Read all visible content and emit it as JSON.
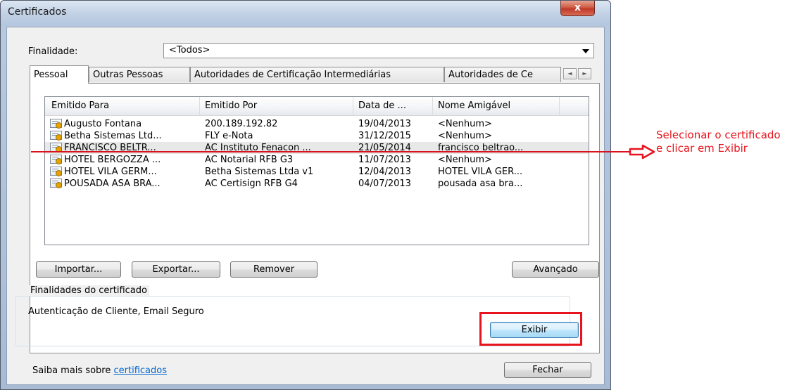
{
  "window": {
    "title": "Certificados",
    "close_label": "x"
  },
  "purpose": {
    "label": "Finalidade:",
    "value": "<Todos>"
  },
  "tabs": [
    "Pessoal",
    "Outras Pessoas",
    "Autoridades de Certificação Intermediárias",
    "Autoridades de Ce"
  ],
  "list": {
    "columns": [
      "Emitido Para",
      "Emitido Por",
      "Data de ...",
      "Nome Amigável"
    ],
    "rows": [
      {
        "issued_to": "Augusto Fontana",
        "issued_by": "200.189.192.82",
        "expires": "19/04/2013",
        "friendly": "<Nenhum>"
      },
      {
        "issued_to": "Betha Sistemas Ltd...",
        "issued_by": "FLY e-Nota",
        "expires": "31/12/2015",
        "friendly": "<Nenhum>"
      },
      {
        "issued_to": "FRANCISCO BELTR...",
        "issued_by": "AC Instituto Fenacon ...",
        "expires": "21/05/2014",
        "friendly": "francisco beltrao..."
      },
      {
        "issued_to": "HOTEL BERGOZZA ...",
        "issued_by": "AC Notarial RFB G3",
        "expires": "11/07/2013",
        "friendly": "<Nenhum>"
      },
      {
        "issued_to": "HOTEL VILA GERM...",
        "issued_by": "Betha Sistemas Ltda v1",
        "expires": "12/04/2013",
        "friendly": "HOTEL VILA GER..."
      },
      {
        "issued_to": "POUSADA ASA BRA...",
        "issued_by": "AC Certisign RFB G4",
        "expires": "04/07/2013",
        "friendly": "pousada asa bra..."
      }
    ]
  },
  "buttons": {
    "import": "Importar...",
    "export": "Exportar...",
    "remove": "Remover",
    "advanced": "Avançado",
    "view": "Exibir",
    "close": "Fechar"
  },
  "purposes_group": {
    "title": "Finalidades do certificado",
    "value": "Autenticação de Cliente, Email Seguro"
  },
  "learn_more": {
    "prefix": "Saiba mais sobre ",
    "link": "certificados"
  },
  "annotation": {
    "text": "Selecionar o certificado e clicar em Exibir",
    "color": "#e8131d"
  }
}
